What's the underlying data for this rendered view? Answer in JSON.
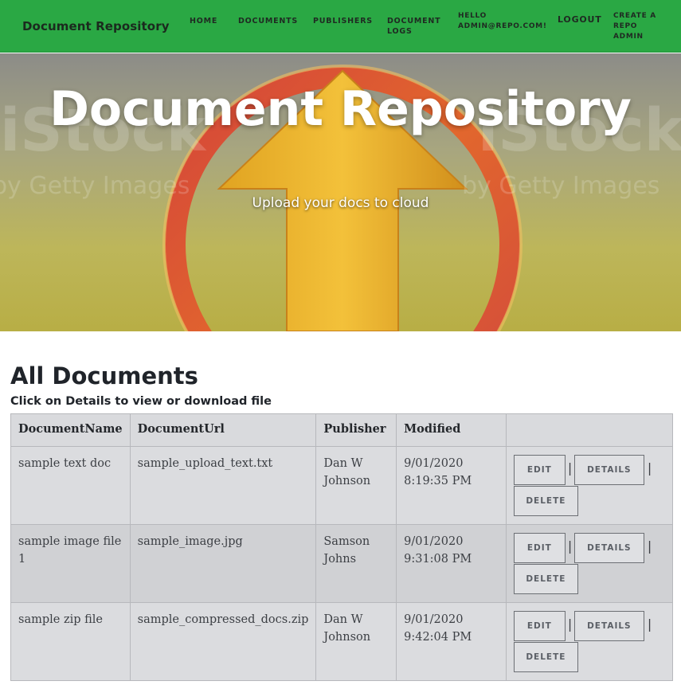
{
  "nav": {
    "brand": "Document Repository",
    "links": {
      "home": "HOME",
      "documents": "DOCUMENTS",
      "publishers": "PUBLISHERS",
      "logs": "DOCUMENT\nLOGS",
      "hello": "HELLO\nADMIN@REPO.COM!",
      "logout": "LOGOUT",
      "create_admin": "CREATE A\nREPO\nADMIN"
    },
    "color": "#2aa844"
  },
  "hero": {
    "title": "Document Repository",
    "subtitle": "Upload your docs to cloud",
    "watermark_main": "iStock",
    "watermark_sub": "by Getty Images"
  },
  "main": {
    "title": "All Documents",
    "hint": "Click on Details to view or download file",
    "table": {
      "headers": [
        "DocumentName",
        "DocumentUrl",
        "Publisher",
        "Modified",
        ""
      ],
      "rows": [
        {
          "name": "sample text doc",
          "url": "sample_upload_text.txt",
          "publisher": "Dan W Johnson",
          "modified": "9/01/2020 8:19:35 PM"
        },
        {
          "name": "sample image file 1",
          "url": "sample_image.jpg",
          "publisher": "Samson Johns",
          "modified": "9/01/2020 9:31:08 PM"
        },
        {
          "name": "sample zip file",
          "url": "sample_compressed_docs.zip",
          "publisher": "Dan W Johnson",
          "modified": "9/01/2020 9:42:04 PM"
        }
      ],
      "actions": {
        "edit": "EDIT",
        "details": "DETAILS",
        "delete": "DELETE",
        "separator": "|"
      }
    }
  }
}
